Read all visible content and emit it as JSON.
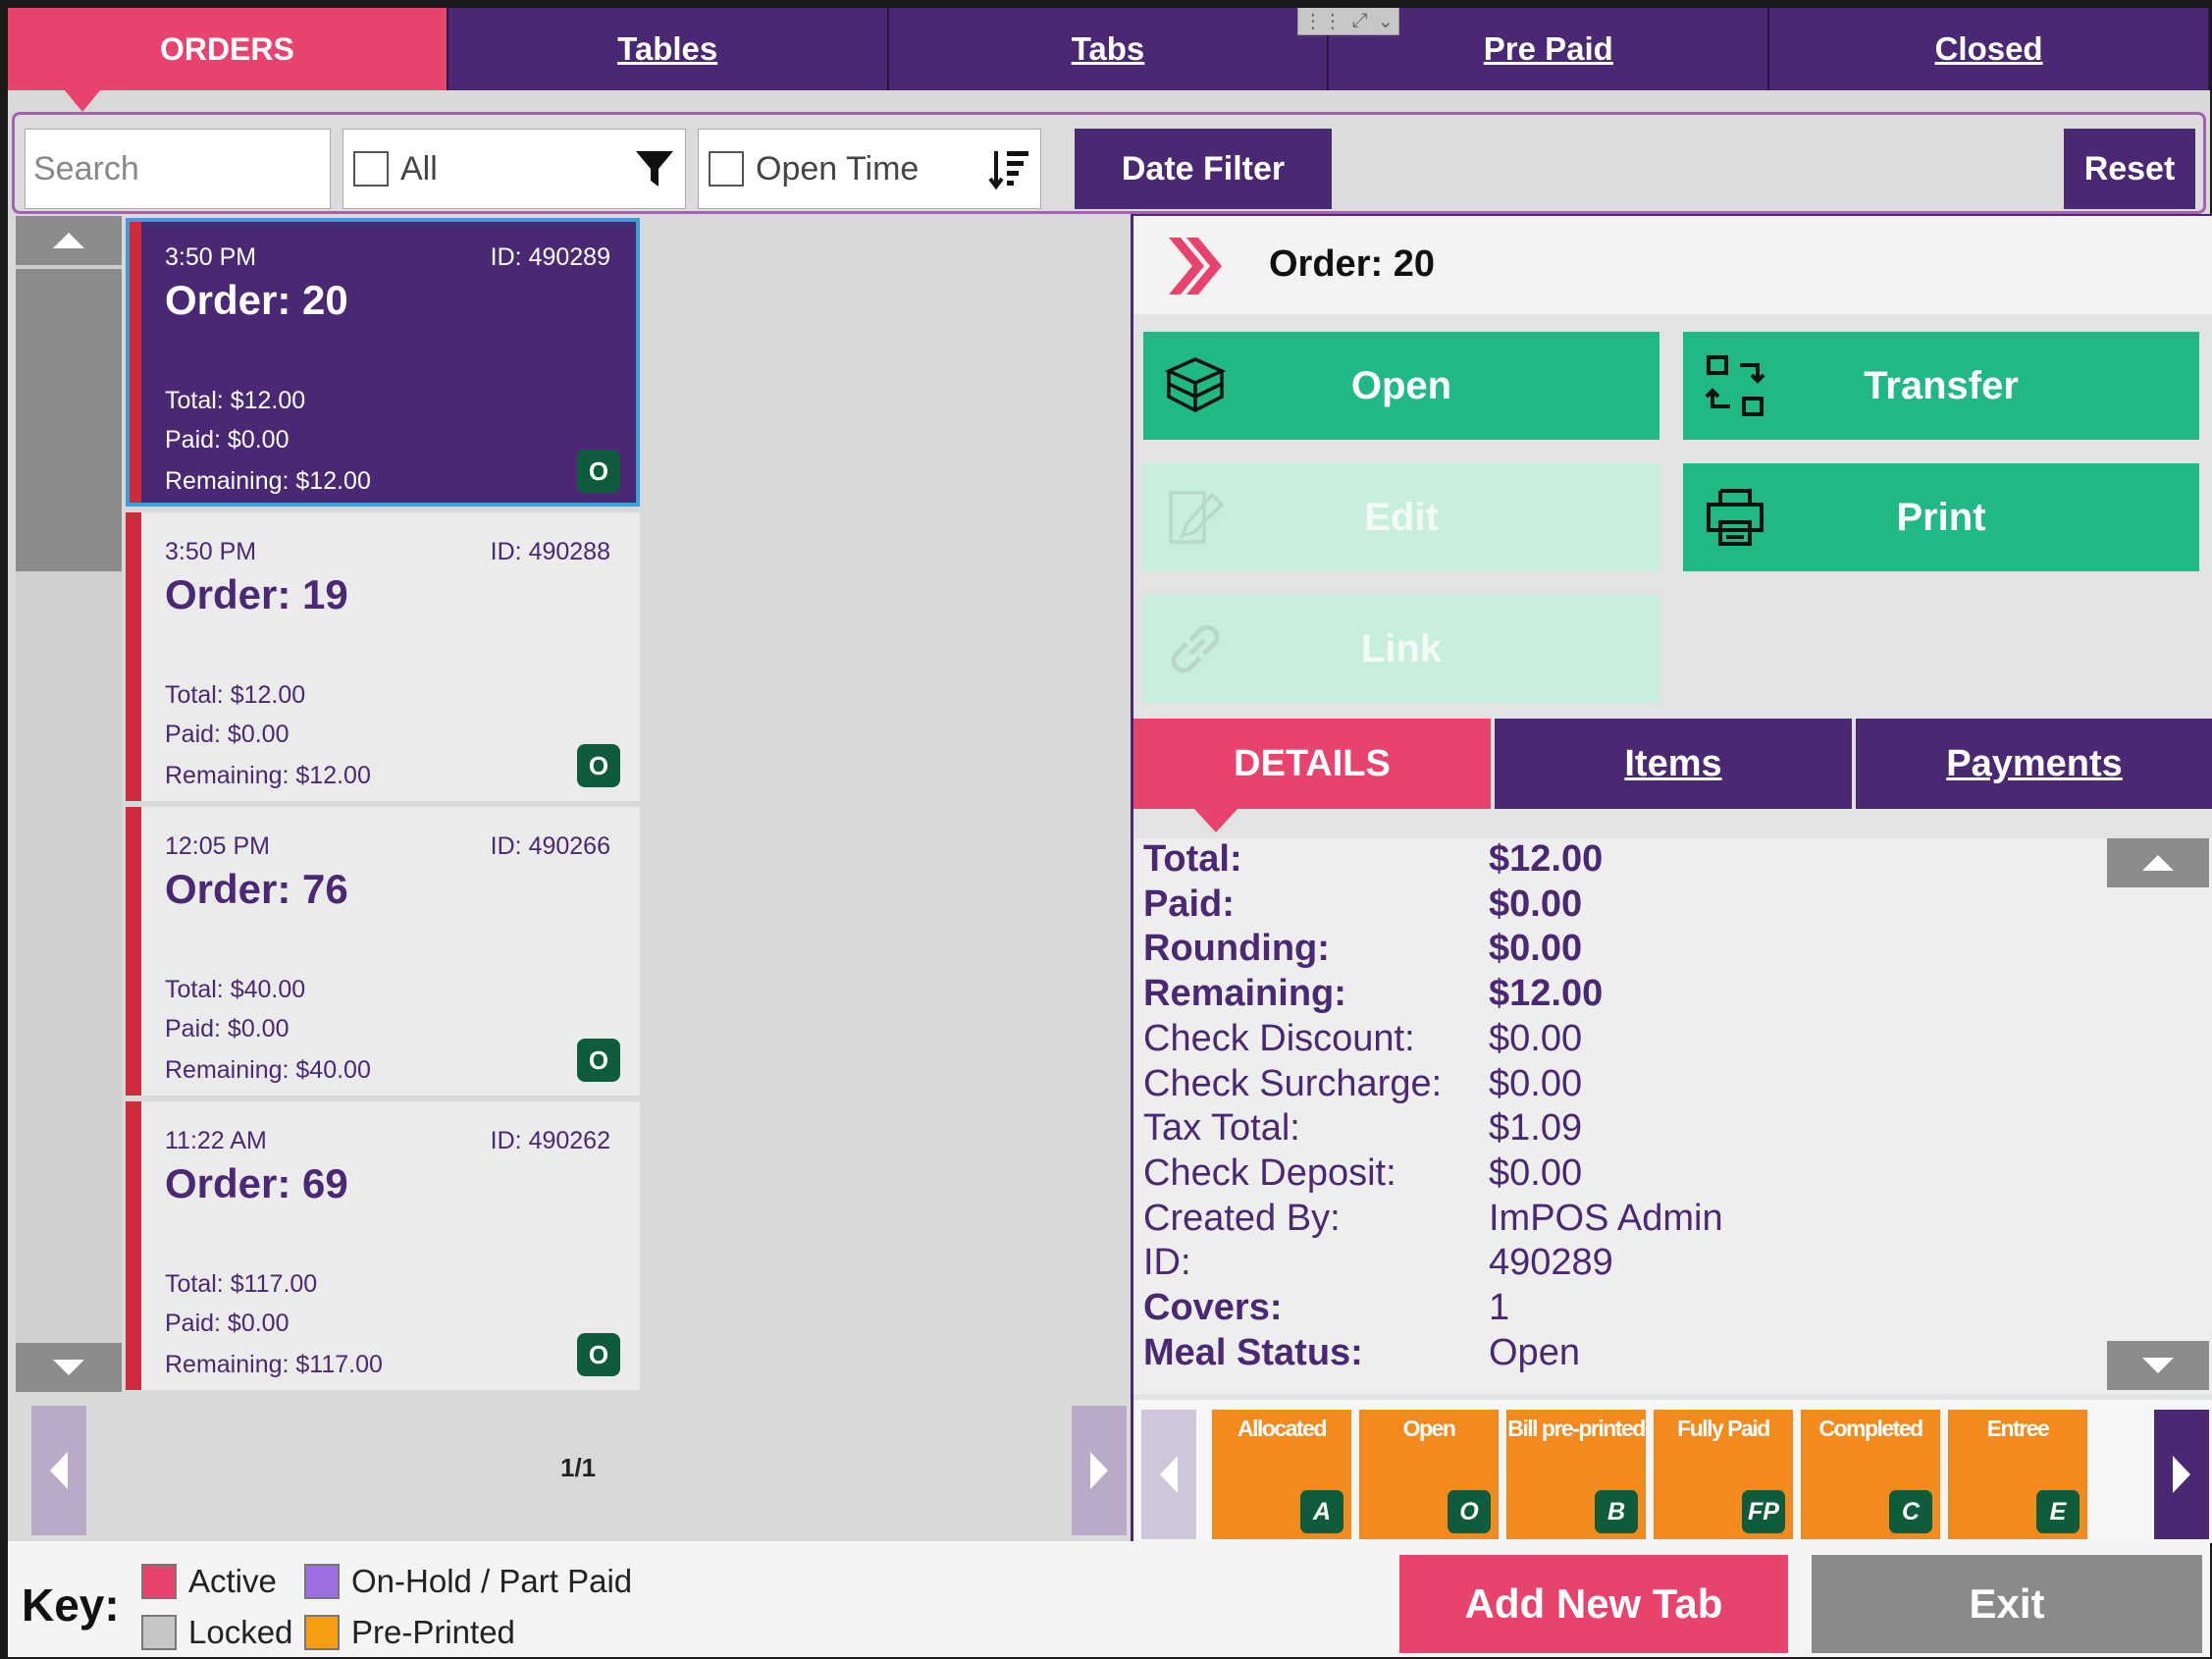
{
  "top_tabs": [
    {
      "label": "ORDERS"
    },
    {
      "label": "Tables"
    },
    {
      "label": "Tabs"
    },
    {
      "label": "Pre Paid"
    },
    {
      "label": "Closed"
    }
  ],
  "filters": {
    "search_placeholder": "Search",
    "category": "All",
    "sort": "Open Time",
    "date_filter_label": "Date Filter",
    "reset_label": "Reset"
  },
  "orders": [
    {
      "time": "3:50 PM",
      "id": "ID: 490289",
      "title": "Order: 20",
      "total": "Total: $12.00",
      "paid": "Paid: $0.00",
      "remaining": "Remaining: $12.00",
      "badge": "O"
    },
    {
      "time": "3:50 PM",
      "id": "ID: 490288",
      "title": "Order: 19",
      "total": "Total: $12.00",
      "paid": "Paid: $0.00",
      "remaining": "Remaining: $12.00",
      "badge": "O"
    },
    {
      "time": "12:05 PM",
      "id": "ID: 490266",
      "title": "Order: 76",
      "total": "Total: $40.00",
      "paid": "Paid: $0.00",
      "remaining": "Remaining: $40.00",
      "badge": "O"
    },
    {
      "time": "11:22 AM",
      "id": "ID: 490262",
      "title": "Order: 69",
      "total": "Total: $117.00",
      "paid": "Paid: $0.00",
      "remaining": "Remaining: $117.00",
      "badge": "O"
    }
  ],
  "pager": {
    "label": "1/1"
  },
  "detail": {
    "title": "Order: 20",
    "actions": {
      "open": "Open",
      "transfer": "Transfer",
      "edit": "Edit",
      "print": "Print",
      "link": "Link"
    },
    "tabs": [
      {
        "label": "DETAILS"
      },
      {
        "label": "Items"
      },
      {
        "label": "Payments"
      }
    ],
    "rows": [
      {
        "label": "Total:",
        "value": "$12.00"
      },
      {
        "label": "Paid:",
        "value": "$0.00"
      },
      {
        "label": "Rounding:",
        "value": "$0.00"
      },
      {
        "label": "Remaining:",
        "value": "$12.00"
      },
      {
        "label": "Check Discount:",
        "value": "$0.00"
      },
      {
        "label": "Check Surcharge:",
        "value": "$0.00"
      },
      {
        "label": "Tax Total:",
        "value": "$1.09"
      },
      {
        "label": "Check Deposit:",
        "value": "$0.00"
      },
      {
        "label": "Created By:",
        "value": "ImPOS Admin"
      },
      {
        "label": "ID:",
        "value": "490289"
      },
      {
        "label": "Covers:",
        "value": "1"
      },
      {
        "label": "Meal Status:",
        "value": "Open"
      }
    ],
    "statuses": [
      {
        "label": "Allocated",
        "badge": "A"
      },
      {
        "label": "Open",
        "badge": "O"
      },
      {
        "label": "Bill pre-printed",
        "badge": "B"
      },
      {
        "label": "Fully Paid",
        "badge": "FP"
      },
      {
        "label": "Completed",
        "badge": "C"
      },
      {
        "label": "Entree",
        "badge": "E"
      }
    ]
  },
  "key": {
    "title": "Key:",
    "items": [
      {
        "label": "Active",
        "color": "#e8436d"
      },
      {
        "label": "On-Hold / Part Paid",
        "color": "#9b6fe0"
      },
      {
        "label": "Locked",
        "color": "#c6c6c6"
      },
      {
        "label": "Pre-Printed",
        "color": "#f59c12"
      }
    ]
  },
  "bottom": {
    "add_new_tab": "Add New Tab",
    "exit": "Exit"
  },
  "colors": {
    "purple": "#4a2873",
    "pink": "#e8436d",
    "green": "#1fb886",
    "orange": "#f28a1e",
    "red_bar": "#cf2b3b"
  }
}
